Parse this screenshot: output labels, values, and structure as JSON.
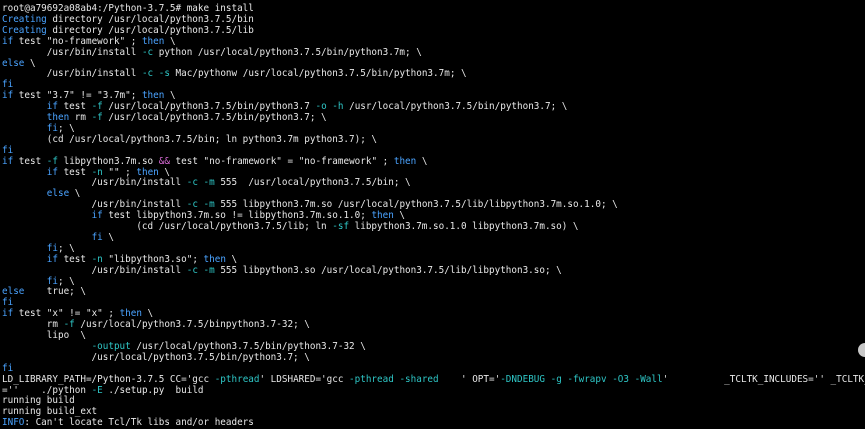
{
  "colors": {
    "background": "#000000",
    "text": "#e8e8e8",
    "keyword": "#4aa3ff",
    "operator": "#d86ad6",
    "flag": "#2ec6c6"
  },
  "lines": [
    [
      {
        "t": "root@a79692a08ab4:/Python-3.7.5# make install",
        "c": "w"
      }
    ],
    [
      {
        "t": "Creating",
        "c": "b"
      },
      {
        "t": " directory /usr/local/python3.7.5/bin",
        "c": "w"
      }
    ],
    [
      {
        "t": "Creating",
        "c": "b"
      },
      {
        "t": " directory /usr/local/python3.7.5/lib",
        "c": "w"
      }
    ],
    [
      {
        "t": "if",
        "c": "b"
      },
      {
        "t": " test \"no-framework\" ; ",
        "c": "w"
      },
      {
        "t": "then",
        "c": "b"
      },
      {
        "t": " \\",
        "c": "w"
      }
    ],
    [
      {
        "t": "        /usr/bin/install ",
        "c": "w"
      },
      {
        "t": "-c",
        "c": "c"
      },
      {
        "t": " python /usr/local/python3.7.5/bin/python3.7m; \\",
        "c": "w"
      }
    ],
    [
      {
        "t": "else",
        "c": "b"
      },
      {
        "t": " \\",
        "c": "w"
      }
    ],
    [
      {
        "t": "        /usr/bin/install ",
        "c": "w"
      },
      {
        "t": "-c",
        "c": "c"
      },
      {
        "t": " ",
        "c": "w"
      },
      {
        "t": "-s",
        "c": "c"
      },
      {
        "t": " Mac/pythonw /usr/local/python3.7.5/bin/python3.7m; \\",
        "c": "w"
      }
    ],
    [
      {
        "t": "fi",
        "c": "b"
      }
    ],
    [
      {
        "t": "if",
        "c": "b"
      },
      {
        "t": " test \"3.7\" != \"3.7m\"; ",
        "c": "w"
      },
      {
        "t": "then",
        "c": "b"
      },
      {
        "t": " \\",
        "c": "w"
      }
    ],
    [
      {
        "t": "        ",
        "c": "w"
      },
      {
        "t": "if",
        "c": "b"
      },
      {
        "t": " test ",
        "c": "w"
      },
      {
        "t": "-f",
        "c": "c"
      },
      {
        "t": " /usr/local/python3.7.5/bin/python3.7 ",
        "c": "w"
      },
      {
        "t": "-o",
        "c": "c"
      },
      {
        "t": " ",
        "c": "w"
      },
      {
        "t": "-h",
        "c": "c"
      },
      {
        "t": " /usr/local/python3.7.5/bin/python3.7; \\",
        "c": "w"
      }
    ],
    [
      {
        "t": "        ",
        "c": "w"
      },
      {
        "t": "then",
        "c": "b"
      },
      {
        "t": " rm ",
        "c": "w"
      },
      {
        "t": "-f",
        "c": "c"
      },
      {
        "t": " /usr/local/python3.7.5/bin/python3.7; \\",
        "c": "w"
      }
    ],
    [
      {
        "t": "        ",
        "c": "w"
      },
      {
        "t": "fi",
        "c": "b"
      },
      {
        "t": "; \\",
        "c": "w"
      }
    ],
    [
      {
        "t": "        (cd /usr/local/python3.7.5/bin; ln python3.7m python3.7); \\",
        "c": "w"
      }
    ],
    [
      {
        "t": "fi",
        "c": "b"
      }
    ],
    [
      {
        "t": "if",
        "c": "b"
      },
      {
        "t": " test ",
        "c": "w"
      },
      {
        "t": "-f",
        "c": "c"
      },
      {
        "t": " libpython3.7m.so ",
        "c": "w"
      },
      {
        "t": "&&",
        "c": "p"
      },
      {
        "t": " test \"no-framework\" = \"no-framework\" ; ",
        "c": "w"
      },
      {
        "t": "then",
        "c": "b"
      },
      {
        "t": " \\",
        "c": "w"
      }
    ],
    [
      {
        "t": "        ",
        "c": "w"
      },
      {
        "t": "if",
        "c": "b"
      },
      {
        "t": " test ",
        "c": "w"
      },
      {
        "t": "-n",
        "c": "c"
      },
      {
        "t": " \"\" ; ",
        "c": "w"
      },
      {
        "t": "then",
        "c": "b"
      },
      {
        "t": " \\",
        "c": "w"
      }
    ],
    [
      {
        "t": "                /usr/bin/install ",
        "c": "w"
      },
      {
        "t": "-c",
        "c": "c"
      },
      {
        "t": " ",
        "c": "w"
      },
      {
        "t": "-m",
        "c": "c"
      },
      {
        "t": " 555  /usr/local/python3.7.5/bin; \\",
        "c": "w"
      }
    ],
    [
      {
        "t": "        ",
        "c": "w"
      },
      {
        "t": "else",
        "c": "b"
      },
      {
        "t": " \\",
        "c": "w"
      }
    ],
    [
      {
        "t": "                /usr/bin/install ",
        "c": "w"
      },
      {
        "t": "-c",
        "c": "c"
      },
      {
        "t": " ",
        "c": "w"
      },
      {
        "t": "-m",
        "c": "c"
      },
      {
        "t": " 555 libpython3.7m.so /usr/local/python3.7.5/lib/libpython3.7m.so.1.0; \\",
        "c": "w"
      }
    ],
    [
      {
        "t": "                ",
        "c": "w"
      },
      {
        "t": "if",
        "c": "b"
      },
      {
        "t": " test libpython3.7m.so != libpython3.7m.so.1.0; ",
        "c": "w"
      },
      {
        "t": "then",
        "c": "b"
      },
      {
        "t": " \\",
        "c": "w"
      }
    ],
    [
      {
        "t": "                        (cd /usr/local/python3.7.5/lib; ln ",
        "c": "w"
      },
      {
        "t": "-sf",
        "c": "c"
      },
      {
        "t": " libpython3.7m.so.1.0 libpython3.7m.so) \\",
        "c": "w"
      }
    ],
    [
      {
        "t": "                ",
        "c": "w"
      },
      {
        "t": "fi",
        "c": "b"
      },
      {
        "t": " \\",
        "c": "w"
      }
    ],
    [
      {
        "t": "        ",
        "c": "w"
      },
      {
        "t": "fi",
        "c": "b"
      },
      {
        "t": "; \\",
        "c": "w"
      }
    ],
    [
      {
        "t": "        ",
        "c": "w"
      },
      {
        "t": "if",
        "c": "b"
      },
      {
        "t": " test ",
        "c": "w"
      },
      {
        "t": "-n",
        "c": "c"
      },
      {
        "t": " \"libpython3.so\"; ",
        "c": "w"
      },
      {
        "t": "then",
        "c": "b"
      },
      {
        "t": " \\",
        "c": "w"
      }
    ],
    [
      {
        "t": "                /usr/bin/install ",
        "c": "w"
      },
      {
        "t": "-c",
        "c": "c"
      },
      {
        "t": " ",
        "c": "w"
      },
      {
        "t": "-m",
        "c": "c"
      },
      {
        "t": " 555 libpython3.so /usr/local/python3.7.5/lib/libpython3.so; \\",
        "c": "w"
      }
    ],
    [
      {
        "t": "        ",
        "c": "w"
      },
      {
        "t": "fi",
        "c": "b"
      },
      {
        "t": "; \\",
        "c": "w"
      }
    ],
    [
      {
        "t": "else",
        "c": "b"
      },
      {
        "t": "    true; \\",
        "c": "w"
      }
    ],
    [
      {
        "t": "fi",
        "c": "b"
      }
    ],
    [
      {
        "t": "if",
        "c": "b"
      },
      {
        "t": " test \"x\" != \"x\" ; ",
        "c": "w"
      },
      {
        "t": "then",
        "c": "b"
      },
      {
        "t": " \\",
        "c": "w"
      }
    ],
    [
      {
        "t": "        rm ",
        "c": "w"
      },
      {
        "t": "-f",
        "c": "c"
      },
      {
        "t": " /usr/local/python3.7.5/binpython3.7-32; \\",
        "c": "w"
      }
    ],
    [
      {
        "t": "        lipo  \\",
        "c": "w"
      }
    ],
    [
      {
        "t": "                ",
        "c": "w"
      },
      {
        "t": "-output",
        "c": "c"
      },
      {
        "t": " /usr/local/python3.7.5/bin/python3.7-32 \\",
        "c": "w"
      }
    ],
    [
      {
        "t": "                /usr/local/python3.7.5/bin/python3.7; \\",
        "c": "w"
      }
    ],
    [
      {
        "t": "fi",
        "c": "b"
      }
    ],
    [
      {
        "t": "LD_LIBRARY_PATH=/Python-3.7.5 CC='gcc ",
        "c": "w"
      },
      {
        "t": "-pthread",
        "c": "c"
      },
      {
        "t": "' LDSHARED='gcc ",
        "c": "w"
      },
      {
        "t": "-pthread",
        "c": "c"
      },
      {
        "t": " ",
        "c": "w"
      },
      {
        "t": "-shared",
        "c": "c"
      },
      {
        "t": "    ' OPT='",
        "c": "w"
      },
      {
        "t": "-DNDEBUG",
        "c": "c"
      },
      {
        "t": " ",
        "c": "w"
      },
      {
        "t": "-g",
        "c": "c"
      },
      {
        "t": " ",
        "c": "w"
      },
      {
        "t": "-fwrapv",
        "c": "c"
      },
      {
        "t": " ",
        "c": "w"
      },
      {
        "t": "-O3",
        "c": "c"
      },
      {
        "t": " ",
        "c": "w"
      },
      {
        "t": "-Wall",
        "c": "c"
      },
      {
        "t": "'          _TCLTK_INCLUDES='' _TCLTK_LIBS",
        "c": "w"
      }
    ],
    [
      {
        "t": "=''    ./python ",
        "c": "w"
      },
      {
        "t": "-E",
        "c": "c"
      },
      {
        "t": " ./setup.py  build",
        "c": "w"
      }
    ],
    [
      {
        "t": "running build",
        "c": "w"
      }
    ],
    [
      {
        "t": "running build_ext",
        "c": "w"
      }
    ],
    [
      {
        "t": "INFO",
        "c": "b"
      },
      {
        "t": ": Can't locate Tcl/Tk libs and/or headers",
        "c": "w"
      }
    ]
  ]
}
